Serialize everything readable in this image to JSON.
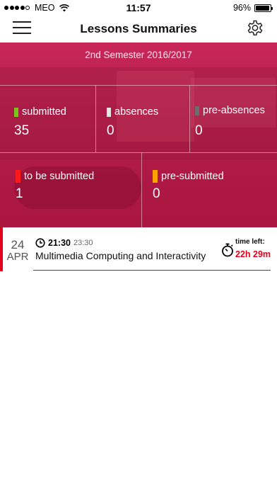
{
  "status_bar": {
    "carrier": "MEO",
    "time": "11:57",
    "battery": "96%",
    "battery_level": 0.96,
    "signal_bars": 4,
    "signal_max": 5
  },
  "nav": {
    "title": "Lessons Summaries",
    "menu_icon": "hamburger-menu-icon",
    "settings_icon": "gear-icon"
  },
  "header": {
    "semester": "2nd Semester 2016/2017"
  },
  "stats": {
    "submitted": {
      "label": "submitted",
      "value": "35",
      "color": "#7cc520"
    },
    "absences": {
      "label": "absences",
      "value": "0",
      "color": "#e6e6e6"
    },
    "pre_absences": {
      "label": "pre-absences",
      "value": "0",
      "color": "#6d6d6d"
    },
    "to_be_submitted": {
      "label": "to be submitted",
      "value": "1",
      "color": "#ff1a1a"
    },
    "pre_submitted": {
      "label": "pre-submitted",
      "value": "0",
      "color": "#ffa200"
    }
  },
  "lessons": [
    {
      "day": "24",
      "month": "APR",
      "start_time": "21:30",
      "end_time": "23:30",
      "title": "Multimedia Computing and Interactivity",
      "time_left_label": "time left:",
      "time_left": "22h 29m"
    }
  ],
  "colors": {
    "accent_red": "#e4001b",
    "hero": "#b41c4b"
  }
}
